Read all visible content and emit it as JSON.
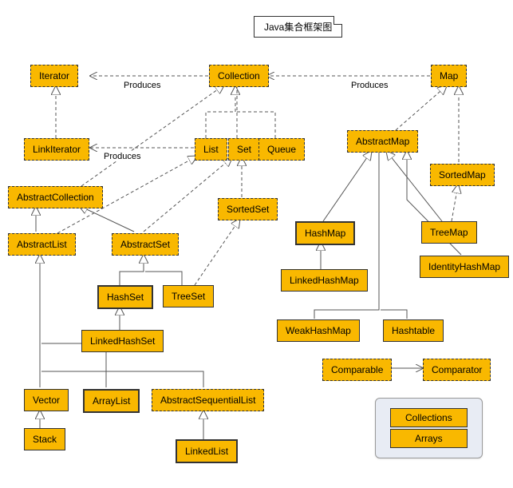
{
  "title": "Java集合框架图",
  "labels": {
    "produces1": "Produces",
    "produces2": "Produces",
    "produces3": "Produces"
  },
  "nodes": {
    "iterator": "Iterator",
    "collection": "Collection",
    "map": "Map",
    "linkIterator": "LinkIterator",
    "list": "List",
    "set": "Set",
    "queue": "Queue",
    "abstractMap": "AbstractMap",
    "sortedMap": "SortedMap",
    "abstractCollection": "AbstractCollection",
    "sortedSet": "SortedSet",
    "hashMap": "HashMap",
    "treeMap": "TreeMap",
    "identityHashMap": "IdentityHashMap",
    "abstractList": "AbstractList",
    "abstractSet": "AbstractSet",
    "linkedHashMap": "LinkedHashMap",
    "hashSet": "HashSet",
    "treeSet": "TreeSet",
    "weakHashMap": "WeakHashMap",
    "hashtable": "Hashtable",
    "linkedHashSet": "LinkedHashSet",
    "comparable": "Comparable",
    "comparator": "Comparator",
    "vector": "Vector",
    "arrayList": "ArrayList",
    "abstractSequentialList": "AbstractSequentialList",
    "stack": "Stack",
    "linkedList": "LinkedList"
  },
  "legend": {
    "collections": "Collections",
    "arrays": "Arrays"
  },
  "relations": [
    {
      "from": "Collection",
      "to": "Iterator",
      "type": "produces"
    },
    {
      "from": "Map",
      "to": "Collection",
      "type": "produces"
    },
    {
      "from": "List",
      "to": "LinkIterator",
      "type": "produces"
    },
    {
      "from": "List",
      "to": "Collection",
      "type": "extends-interface"
    },
    {
      "from": "Set",
      "to": "Collection",
      "type": "extends-interface"
    },
    {
      "from": "Queue",
      "to": "Collection",
      "type": "extends-interface"
    },
    {
      "from": "AbstractCollection",
      "to": "Collection",
      "type": "implements"
    },
    {
      "from": "AbstractList",
      "to": "AbstractCollection",
      "type": "extends"
    },
    {
      "from": "AbstractList",
      "to": "List",
      "type": "implements"
    },
    {
      "from": "AbstractSet",
      "to": "AbstractCollection",
      "type": "extends"
    },
    {
      "from": "AbstractSet",
      "to": "Set",
      "type": "implements"
    },
    {
      "from": "SortedSet",
      "to": "Set",
      "type": "extends-interface"
    },
    {
      "from": "HashSet",
      "to": "AbstractSet",
      "type": "extends"
    },
    {
      "from": "TreeSet",
      "to": "AbstractSet",
      "type": "extends"
    },
    {
      "from": "TreeSet",
      "to": "SortedSet",
      "type": "implements"
    },
    {
      "from": "LinkedHashSet",
      "to": "HashSet",
      "type": "extends"
    },
    {
      "from": "Vector",
      "to": "AbstractList",
      "type": "extends"
    },
    {
      "from": "ArrayList",
      "to": "AbstractList",
      "type": "extends"
    },
    {
      "from": "AbstractSequentialList",
      "to": "AbstractList",
      "type": "extends"
    },
    {
      "from": "Stack",
      "to": "Vector",
      "type": "extends"
    },
    {
      "from": "LinkedList",
      "to": "AbstractSequentialList",
      "type": "extends"
    },
    {
      "from": "LinkIterator",
      "to": "Iterator",
      "type": "extends-interface"
    },
    {
      "from": "AbstractMap",
      "to": "Map",
      "type": "implements"
    },
    {
      "from": "SortedMap",
      "to": "Map",
      "type": "extends-interface"
    },
    {
      "from": "HashMap",
      "to": "AbstractMap",
      "type": "extends"
    },
    {
      "from": "TreeMap",
      "to": "AbstractMap",
      "type": "extends"
    },
    {
      "from": "TreeMap",
      "to": "SortedMap",
      "type": "implements"
    },
    {
      "from": "IdentityHashMap",
      "to": "AbstractMap",
      "type": "extends"
    },
    {
      "from": "WeakHashMap",
      "to": "AbstractMap",
      "type": "extends"
    },
    {
      "from": "Hashtable",
      "to": "AbstractMap",
      "type": "extends"
    },
    {
      "from": "LinkedHashMap",
      "to": "HashMap",
      "type": "extends"
    },
    {
      "from": "Comparable",
      "to": "Comparator",
      "type": "bidirectional"
    }
  ]
}
